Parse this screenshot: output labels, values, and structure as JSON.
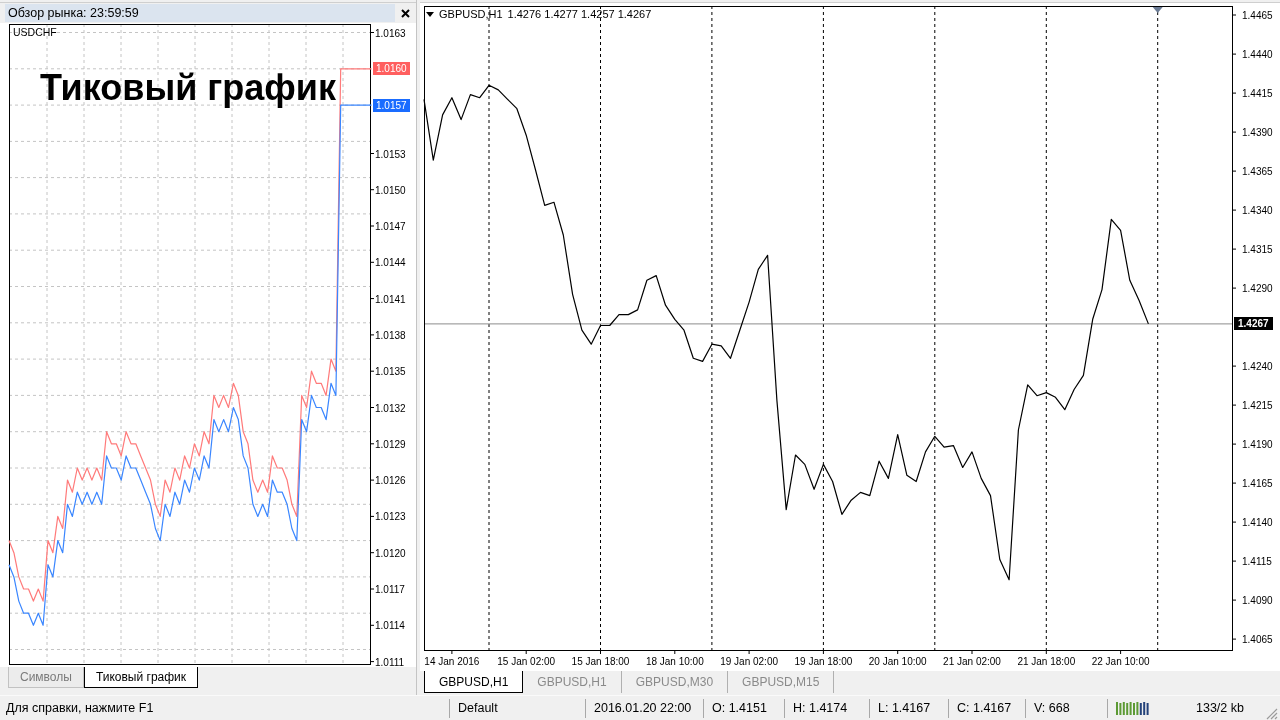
{
  "market_watch": {
    "title": "Обзор рынка: 23:59:59",
    "symbol": "USDCHF",
    "caption": "Тиковый график",
    "chart_data": {
      "type": "line",
      "grid": true,
      "ylim": [
        1.01108,
        1.01637
      ],
      "yticks": [
        {
          "value": 1.0163,
          "label": "1.0163"
        },
        {
          "value": 1.0153,
          "label": "1.0153"
        },
        {
          "value": 1.015,
          "label": "1.0150"
        },
        {
          "value": 1.0147,
          "label": "1.0147"
        },
        {
          "value": 1.0144,
          "label": "1.0144"
        },
        {
          "value": 1.0141,
          "label": "1.0141"
        },
        {
          "value": 1.0138,
          "label": "1.0138"
        },
        {
          "value": 1.0135,
          "label": "1.0135"
        },
        {
          "value": 1.0132,
          "label": "1.0132"
        },
        {
          "value": 1.0129,
          "label": "1.0129"
        },
        {
          "value": 1.0126,
          "label": "1.0126"
        },
        {
          "value": 1.0123,
          "label": "1.0123"
        },
        {
          "value": 1.012,
          "label": "1.0120"
        },
        {
          "value": 1.0117,
          "label": "1.0117"
        },
        {
          "value": 1.0114,
          "label": "1.0114"
        },
        {
          "value": 1.0111,
          "label": "1.0111"
        }
      ],
      "series": [
        {
          "color": "#ff7a7a",
          "values": [
            1.0121,
            1.012,
            1.0118,
            1.0117,
            1.0117,
            1.0116,
            1.0117,
            1.0116,
            1.0121,
            1.012,
            1.0123,
            1.0122,
            1.0126,
            1.0125,
            1.0127,
            1.0126,
            1.0127,
            1.0126,
            1.0127,
            1.0126,
            1.013,
            1.0129,
            1.0129,
            1.0128,
            1.013,
            1.0129,
            1.0129,
            1.0128,
            1.0127,
            1.0126,
            1.0124,
            1.0123,
            1.0126,
            1.0125,
            1.0127,
            1.0126,
            1.0128,
            1.0127,
            1.0129,
            1.0128,
            1.013,
            1.0129,
            1.0133,
            1.0132,
            1.0133,
            1.0132,
            1.0134,
            1.0133,
            1.013,
            1.0129,
            1.0126,
            1.0125,
            1.0126,
            1.0125,
            1.0128,
            1.0127,
            1.0127,
            1.0126,
            1.0124,
            1.0123,
            1.0133,
            1.0132,
            1.0135,
            1.0134,
            1.0134,
            1.0133,
            1.0136,
            1.0135,
            1.016,
            1.016,
            1.016,
            1.016,
            1.016,
            1.016,
            1.016
          ]
        },
        {
          "color": "#3a86ff",
          "values": [
            1.0119,
            1.0118,
            1.0116,
            1.0115,
            1.0115,
            1.0114,
            1.0115,
            1.0114,
            1.0119,
            1.0118,
            1.0121,
            1.012,
            1.0124,
            1.0123,
            1.0125,
            1.0124,
            1.0125,
            1.0124,
            1.0125,
            1.0124,
            1.0128,
            1.0127,
            1.0127,
            1.0126,
            1.0128,
            1.0127,
            1.0127,
            1.0126,
            1.0125,
            1.0124,
            1.0122,
            1.0121,
            1.0124,
            1.0123,
            1.0125,
            1.0124,
            1.0126,
            1.0125,
            1.0127,
            1.0126,
            1.0128,
            1.0127,
            1.0131,
            1.013,
            1.0131,
            1.013,
            1.0132,
            1.0131,
            1.0128,
            1.0127,
            1.0124,
            1.0123,
            1.0124,
            1.0123,
            1.0126,
            1.0125,
            1.0125,
            1.0124,
            1.0122,
            1.0121,
            1.0131,
            1.013,
            1.0133,
            1.0132,
            1.0132,
            1.0131,
            1.0134,
            1.0133,
            1.0157,
            1.0157,
            1.0157,
            1.0157,
            1.0157,
            1.0157,
            1.0157
          ]
        }
      ]
    },
    "price_tags": [
      {
        "text": "1.0160",
        "color": "#ff5f5f"
      },
      {
        "text": "1.0157",
        "color": "#1a6cff"
      }
    ],
    "tabs": [
      {
        "label": "Символы",
        "selected": false
      },
      {
        "label": "Тиковый график",
        "selected": true
      }
    ]
  },
  "chart": {
    "symbol": "GBPUSD,H1",
    "quote": "1.4276 1.4277 1.4257 1.4267",
    "chart_data": {
      "type": "line",
      "grid": true,
      "ylim": [
        1.4058,
        1.44708
      ],
      "categories": [
        null,
        null,
        null,
        "14 Jan 2016",
        null,
        null,
        null,
        null,
        null,
        null,
        null,
        "15 Jan 02:00",
        null,
        null,
        null,
        null,
        null,
        null,
        null,
        "15 Jan 18:00",
        null,
        null,
        null,
        null,
        null,
        null,
        null,
        "18 Jan 10:00",
        null,
        null,
        null,
        null,
        null,
        null,
        null,
        "19 Jan 02:00",
        null,
        null,
        null,
        null,
        null,
        null,
        null,
        "19 Jan 18:00",
        null,
        null,
        null,
        null,
        null,
        null,
        null,
        "20 Jan 10:00",
        null,
        null,
        null,
        null,
        null,
        null,
        null,
        "21 Jan 02:00",
        null,
        null,
        null,
        null,
        null,
        null,
        null,
        "21 Jan 18:00",
        null,
        null,
        null,
        null,
        null,
        null,
        null,
        "22 Jan 10:00",
        null,
        null,
        null,
        null,
        null,
        null,
        null,
        null,
        null,
        null,
        null,
        null
      ],
      "yticks": [
        {
          "value": 1.4465,
          "label": "1.4465"
        },
        {
          "value": 1.444,
          "label": "1.4440"
        },
        {
          "value": 1.4415,
          "label": "1.4415"
        },
        {
          "value": 1.439,
          "label": "1.4390"
        },
        {
          "value": 1.4365,
          "label": "1.4365"
        },
        {
          "value": 1.434,
          "label": "1.4340"
        },
        {
          "value": 1.4315,
          "label": "1.4315"
        },
        {
          "value": 1.429,
          "label": "1.4290"
        },
        {
          "value": 1.424,
          "label": "1.4240"
        },
        {
          "value": 1.4215,
          "label": "1.4215"
        },
        {
          "value": 1.419,
          "label": "1.4190"
        },
        {
          "value": 1.4165,
          "label": "1.4165"
        },
        {
          "value": 1.414,
          "label": "1.4140"
        },
        {
          "value": 1.4115,
          "label": "1.4115"
        },
        {
          "value": 1.409,
          "label": "1.4090"
        },
        {
          "value": 1.4065,
          "label": "1.4065"
        }
      ],
      "ref_lines": [
        {
          "axis": "y",
          "value": 1.4267,
          "label": "1.4267"
        }
      ],
      "series": [
        {
          "color": "#000000",
          "values": [
            1.4411,
            1.4372,
            1.4401,
            1.4412,
            1.4398,
            1.4414,
            1.4412,
            1.442,
            1.4417,
            1.4411,
            1.4405,
            1.4388,
            1.4366,
            1.4343,
            1.4345,
            1.4324,
            1.4286,
            1.4263,
            1.4254,
            1.4266,
            1.4266,
            1.4273,
            1.4273,
            1.4276,
            1.4295,
            1.4298,
            1.4279,
            1.427,
            1.4263,
            1.4245,
            1.4243,
            1.4254,
            1.4253,
            1.4245,
            1.4263,
            1.4281,
            1.4302,
            1.4311,
            1.4218,
            1.4148,
            1.4183,
            1.4177,
            1.4161,
            1.4177,
            1.4166,
            1.4145,
            1.4154,
            1.4159,
            1.4157,
            1.4179,
            1.4168,
            1.4196,
            1.417,
            1.4166,
            1.4185,
            1.4195,
            1.4188,
            1.4189,
            1.4175,
            1.4185,
            1.4168,
            1.4157,
            1.4116,
            1.4103,
            1.4199,
            1.4228,
            1.4221,
            1.4223,
            1.422,
            1.4212,
            1.4225,
            1.4234,
            1.427,
            1.4289,
            1.4334,
            1.4327,
            1.4295,
            1.4282,
            1.4267,
            null,
            null,
            null,
            null,
            null,
            null,
            null,
            null,
            null
          ]
        }
      ]
    },
    "tabs": [
      {
        "label": "GBPUSD,H1",
        "selected": true
      },
      {
        "label": "GBPUSD,H1",
        "selected": false
      },
      {
        "label": "GBPUSD,M30",
        "selected": false
      },
      {
        "label": "GBPUSD,M15",
        "selected": false
      }
    ]
  },
  "status_bar": {
    "help": "Для справки, нажмите F1",
    "profile": "Default",
    "time": "2016.01.20 22:00",
    "ohlcv": [
      "O: 1.4151",
      "H: 1.4174",
      "L: 1.4167",
      "C: 1.4167",
      "V: 668"
    ],
    "traffic": "133/2 kb"
  }
}
